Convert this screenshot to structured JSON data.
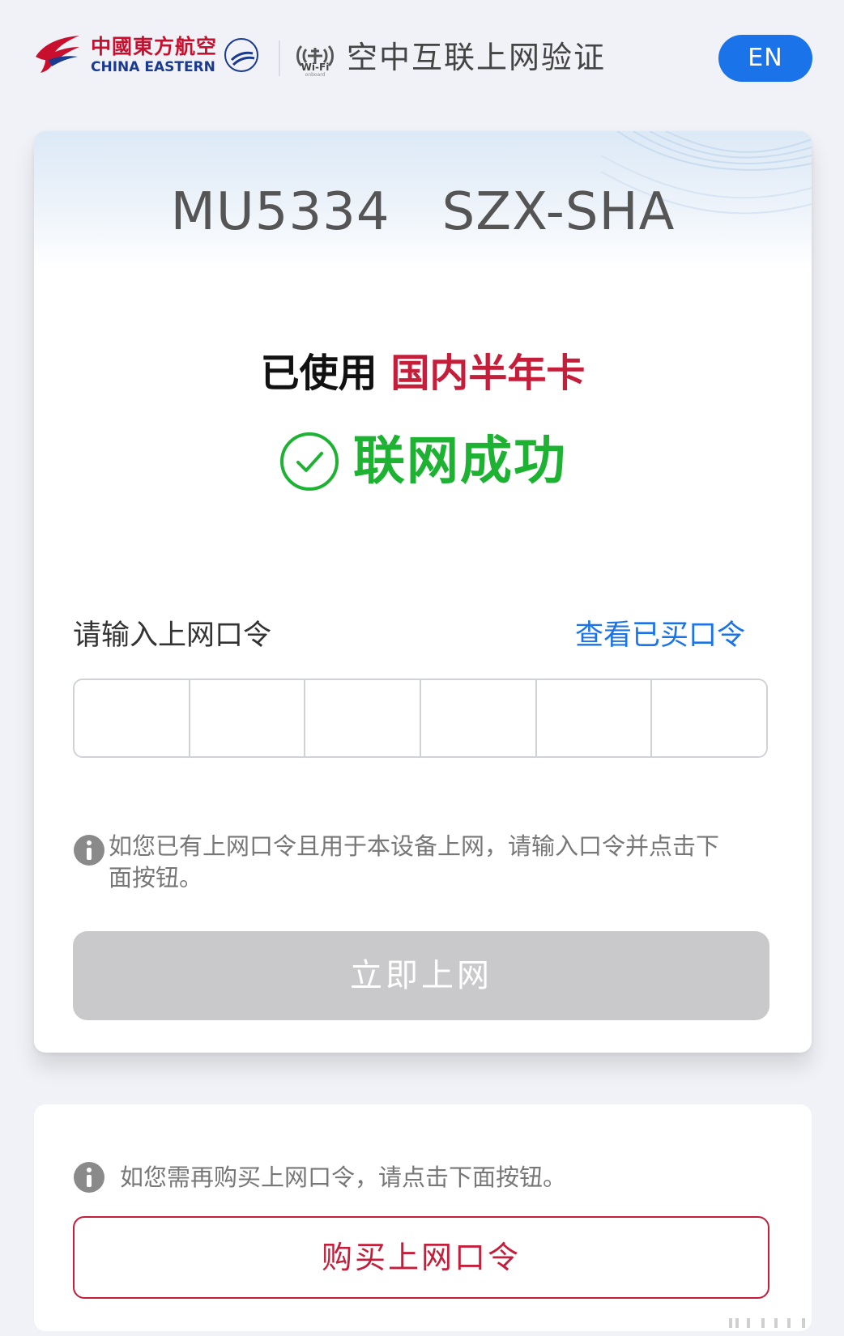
{
  "header": {
    "brand_cn": "中國東方航空",
    "brand_en": "CHINA EASTERN",
    "wifi_label": "Wi-Fi",
    "wifi_sub": "onboard",
    "title": "空中互联上网验证",
    "lang_button": "EN"
  },
  "flight": {
    "number": "MU5334",
    "route": "SZX-SHA"
  },
  "status": {
    "used_label": "已使用",
    "card_name": "国内半年卡",
    "success_text": "联网成功"
  },
  "password": {
    "label": "请输入上网口令",
    "view_link": "查看已买口令",
    "box_count": 6,
    "values": [
      "",
      "",
      "",
      "",
      "",
      ""
    ]
  },
  "hint_existing": "如您已有上网口令且用于本设备上网，请输入口令并点击下面按钮。",
  "go_button": "立即上网",
  "hint_buy": "如您需再购买上网口令，请点击下面按钮。",
  "buy_button": "购买上网口令",
  "colors": {
    "brand_red": "#c41e3a",
    "success_green": "#1eb233",
    "link_blue": "#1a73e8",
    "disabled_gray": "#c9c9cb"
  }
}
